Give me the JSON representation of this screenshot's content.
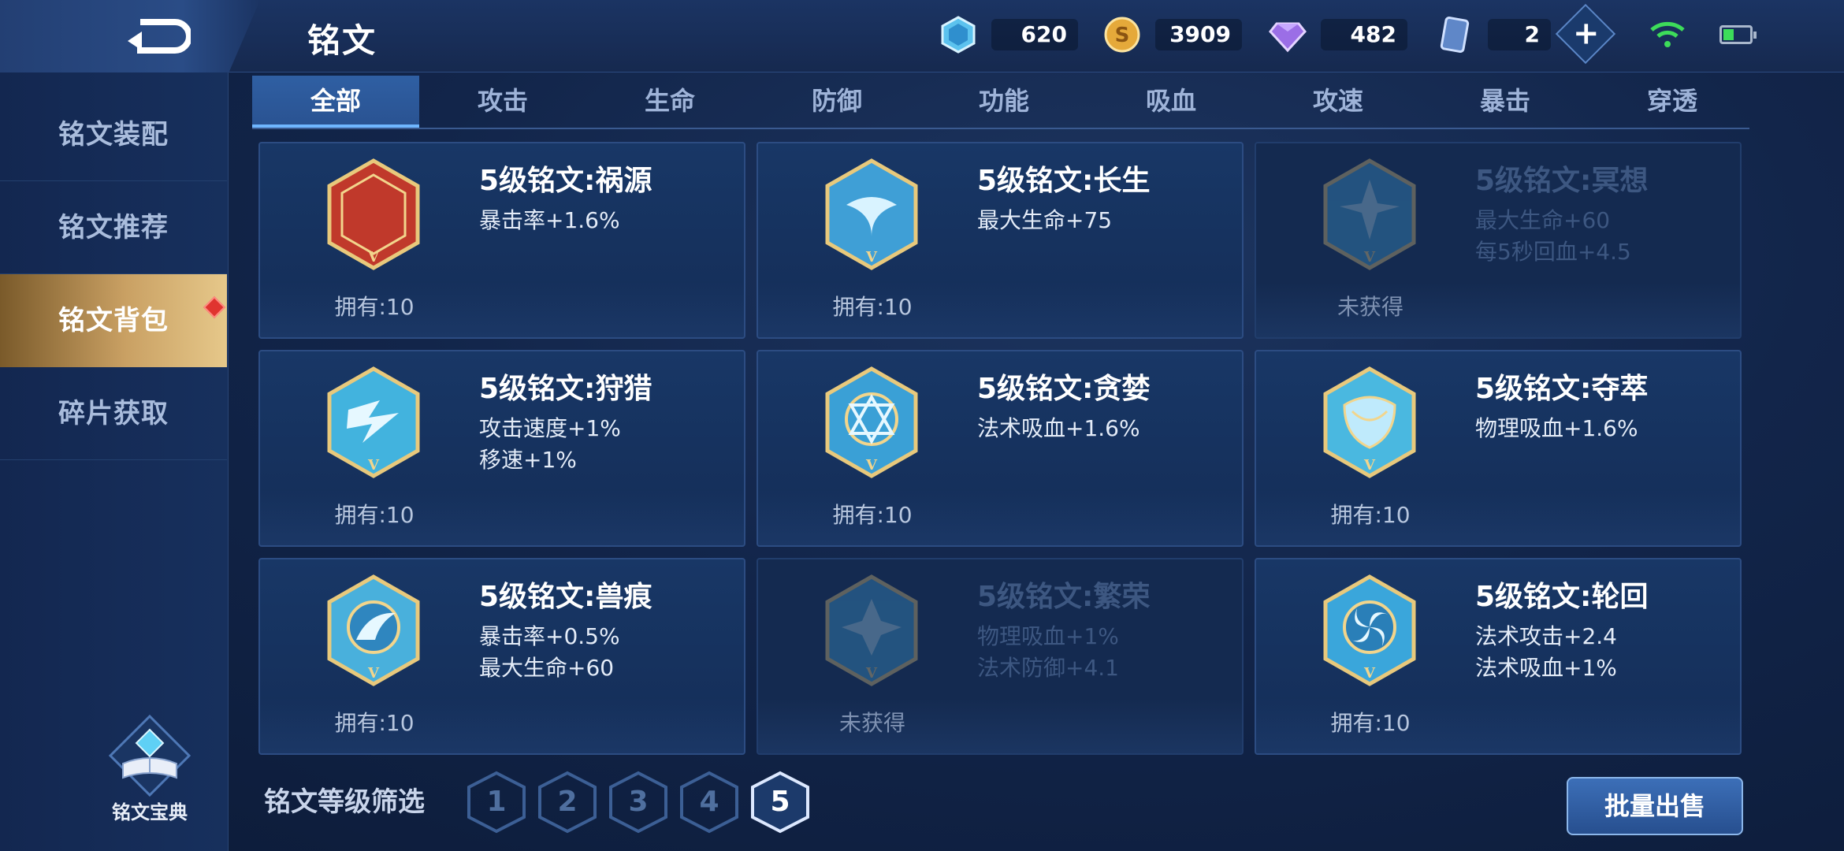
{
  "header": {
    "title": "铭文",
    "currencies": [
      {
        "name": "crystal",
        "icon": "blue-crystal-icon",
        "value": "620"
      },
      {
        "name": "coin",
        "icon": "gold-coin-icon",
        "value": "3909"
      },
      {
        "name": "diamond",
        "icon": "purple-diamond-icon",
        "value": "482"
      },
      {
        "name": "card",
        "icon": "card-icon",
        "value": "2"
      }
    ],
    "plus_label": "+",
    "status": {
      "wifi": "wifi-icon",
      "battery": "battery-icon"
    }
  },
  "sidebar": {
    "items": [
      {
        "label": "铭文装配",
        "active": false
      },
      {
        "label": "铭文推荐",
        "active": false
      },
      {
        "label": "铭文背包",
        "active": true
      },
      {
        "label": "碎片获取",
        "active": false
      }
    ],
    "codex_label": "铭文宝典"
  },
  "tabs": [
    {
      "label": "全部",
      "active": true
    },
    {
      "label": "攻击",
      "active": false
    },
    {
      "label": "生命",
      "active": false
    },
    {
      "label": "防御",
      "active": false
    },
    {
      "label": "功能",
      "active": false
    },
    {
      "label": "吸血",
      "active": false
    },
    {
      "label": "攻速",
      "active": false
    },
    {
      "label": "暴击",
      "active": false
    },
    {
      "label": "穿透",
      "active": false
    }
  ],
  "cards": [
    {
      "title": "5级铭文:祸源",
      "stats": [
        "暴击率+1.6%"
      ],
      "owned": "拥有:10",
      "obtained": true,
      "color": "#c0392b"
    },
    {
      "title": "5级铭文:长生",
      "stats": [
        "最大生命+75"
      ],
      "owned": "拥有:10",
      "obtained": true,
      "color": "#3f9fd6"
    },
    {
      "title": "5级铭文:冥想",
      "stats": [
        "最大生命+60",
        "每5秒回血+4.5"
      ],
      "owned": "未获得",
      "obtained": false,
      "color": "#3f9fd6"
    },
    {
      "title": "5级铭文:狩猎",
      "stats": [
        "攻击速度+1%",
        "移速+1%"
      ],
      "owned": "拥有:10",
      "obtained": true,
      "color": "#42b3de"
    },
    {
      "title": "5级铭文:贪婪",
      "stats": [
        "法术吸血+1.6%"
      ],
      "owned": "拥有:10",
      "obtained": true,
      "color": "#3aa0d6"
    },
    {
      "title": "5级铭文:夺萃",
      "stats": [
        "物理吸血+1.6%"
      ],
      "owned": "拥有:10",
      "obtained": true,
      "color": "#4ab8e0"
    },
    {
      "title": "5级铭文:兽痕",
      "stats": [
        "暴击率+0.5%",
        "最大生命+60"
      ],
      "owned": "拥有:10",
      "obtained": true,
      "color": "#49b0dc"
    },
    {
      "title": "5级铭文:繁荣",
      "stats": [
        "物理吸血+1%",
        "法术防御+4.1"
      ],
      "owned": "未获得",
      "obtained": false,
      "color": "#3f9fd6"
    },
    {
      "title": "5级铭文:轮回",
      "stats": [
        "法术攻击+2.4",
        "法术吸血+1%"
      ],
      "owned": "拥有:10",
      "obtained": true,
      "color": "#3aa6db"
    }
  ],
  "filter": {
    "label": "铭文等级筛选",
    "levels": [
      "1",
      "2",
      "3",
      "4",
      "5"
    ],
    "selected": "5"
  },
  "bulk_sell_label": "批量出售"
}
